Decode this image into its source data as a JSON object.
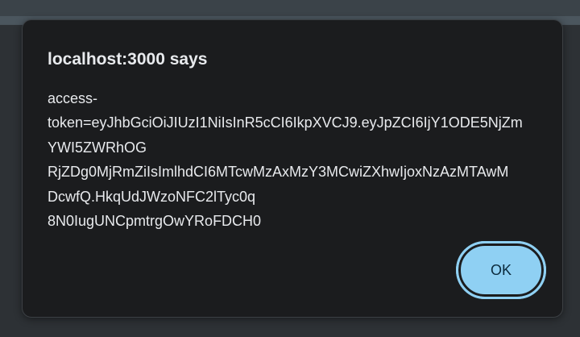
{
  "dialog": {
    "title": "localhost:3000 says",
    "message_lines": [
      "access-",
      "token=eyJhbGciOiJIUzI1NiIsInR5cCI6IkpXVCJ9.eyJpZCI6IjY1ODE5NjZm",
      "YWI5ZWRhOG",
      "RjZDg0MjRmZiIsImlhdCI6MTcwMzAxMzY3MCwiZXhwIjoxNzAzMTAwM",
      "DcwfQ.HkqUdJWzoNFC2lTyc0q",
      "8N0IugUNCpmtrgOwYRoFDCH0"
    ],
    "ok_label": "OK"
  },
  "colors": {
    "dialog_background": "#1b1c1e",
    "button_accent": "#8fd0f3",
    "text": "#e8eaed",
    "page_background": "#2d3135"
  }
}
